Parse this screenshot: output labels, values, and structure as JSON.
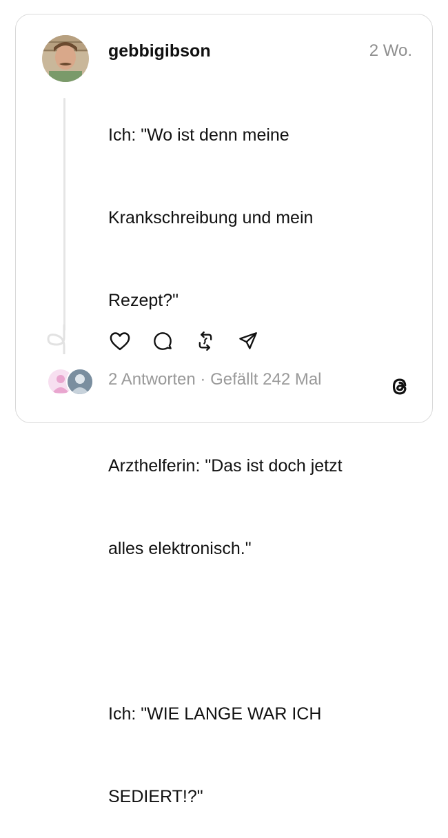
{
  "post": {
    "username": "gebbigibson",
    "timestamp": "2 Wo.",
    "text_lines": [
      "Ich: \"Wo ist denn meine",
      "Krankschreibung und mein",
      "Rezept?\"",
      "",
      "Arzthelferin: \"Das ist doch jetzt",
      "alles elektronisch.\"",
      "",
      "Ich: \"WIE LANGE WAR ICH",
      "SEDIERT!?\""
    ]
  },
  "actions": {
    "icons": [
      "heart-icon",
      "comment-icon",
      "repost-icon",
      "share-icon"
    ]
  },
  "footer": {
    "replies": "2 Antworten",
    "separator": "·",
    "likes": "Gefällt 242 Mal"
  },
  "colors": {
    "text": "#111111",
    "muted": "#8e8e8e",
    "border": "#d9d9d9"
  }
}
